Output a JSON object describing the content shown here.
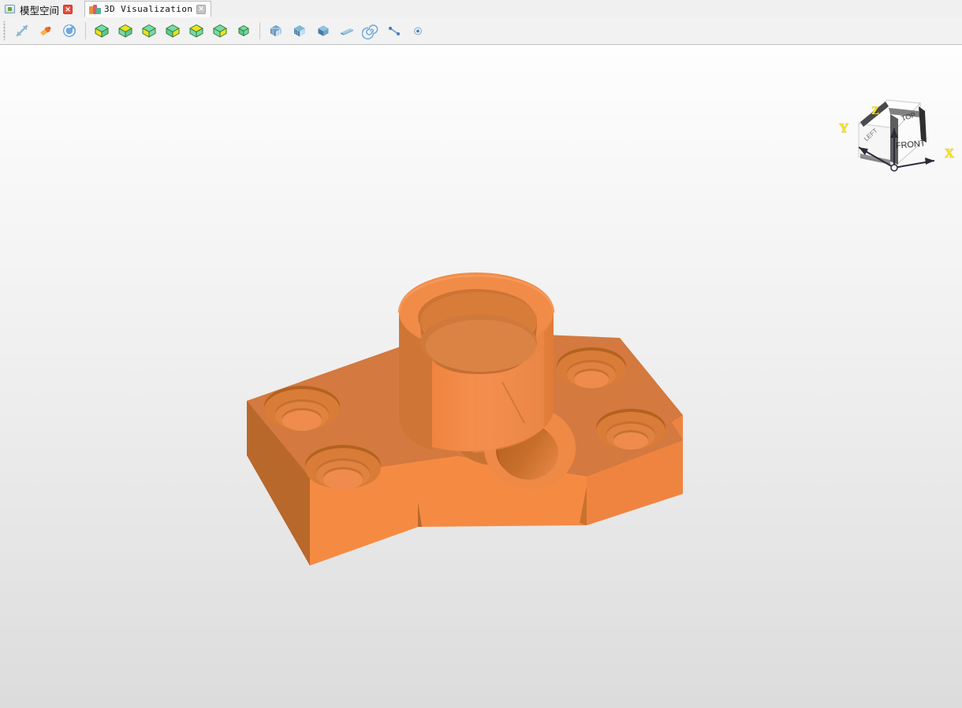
{
  "window": {
    "title": "3D Visualization"
  },
  "tabs": [
    {
      "label": "模型空间",
      "icon": "monitor-icon",
      "active": false,
      "close_label": "✕"
    },
    {
      "label": "3D Visualization",
      "icon": "blocks-icon",
      "active": true,
      "close_label": "✕"
    }
  ],
  "toolbar": {
    "groups": [
      {
        "name": "navigation",
        "buttons": [
          {
            "name": "zoom-extents-button",
            "icon": "diagonal-arrows-icon",
            "title": "Zoom Extents"
          },
          {
            "name": "render-style-button",
            "icon": "paintbrush-icon",
            "title": "Render Style"
          },
          {
            "name": "refresh-view-button",
            "icon": "refresh-circle-icon",
            "title": "Refresh View"
          }
        ]
      },
      {
        "name": "standard-views",
        "buttons": [
          {
            "name": "view-top-button",
            "icon": "cube-top-icon",
            "title": "Top View"
          },
          {
            "name": "view-front-button",
            "icon": "cube-front-icon",
            "title": "Front View"
          },
          {
            "name": "view-left-button",
            "icon": "cube-left-icon",
            "title": "Left View"
          },
          {
            "name": "view-right-button",
            "icon": "cube-right-icon",
            "title": "Right View"
          },
          {
            "name": "view-back-button",
            "icon": "cube-back-icon",
            "title": "Back View"
          },
          {
            "name": "view-bottom-button",
            "icon": "cube-bottom-icon",
            "title": "Bottom View"
          },
          {
            "name": "view-isometric-button",
            "icon": "cube-iso-icon",
            "title": "Isometric View"
          }
        ]
      },
      {
        "name": "display-modes",
        "buttons": [
          {
            "name": "wireframe-mode-button",
            "icon": "wireframe-cube-icon",
            "title": "Wireframe"
          },
          {
            "name": "hidden-line-mode-button",
            "icon": "hidden-line-cube-icon",
            "title": "Hidden Line"
          },
          {
            "name": "shaded-mode-button",
            "icon": "solid-cube-icon",
            "title": "Shaded"
          },
          {
            "name": "section-plane-button",
            "icon": "wedge-icon",
            "title": "Section Plane"
          },
          {
            "name": "spiral-tool-button",
            "icon": "spiral-icon",
            "title": "Spiral"
          },
          {
            "name": "line-tool-button",
            "icon": "line-segment-icon",
            "title": "Line"
          },
          {
            "name": "point-tool-button",
            "icon": "point-icon",
            "title": "Point"
          }
        ]
      }
    ]
  },
  "viewport": {
    "name": "3d-viewport",
    "background_top": "#fefefe",
    "background_bottom": "#dcdcdc",
    "model": {
      "name": "bracket-part",
      "description": "Orange shaded 3D bracket with vertical cylindrical boss, horizontal cylindrical boss with through hole, and four counterbored mounting holes",
      "color_light": "#f5873c",
      "color_mid": "#e87a34",
      "color_dark": "#c9712f",
      "color_shadow": "#b05f26"
    },
    "viewcube": {
      "name": "view-cube",
      "faces": {
        "top": "TOP",
        "front": "FRONT",
        "left": "LEFT"
      },
      "axes": {
        "x": "X",
        "y": "Y",
        "z": "Z"
      },
      "axis_color": "#ffe400"
    }
  }
}
